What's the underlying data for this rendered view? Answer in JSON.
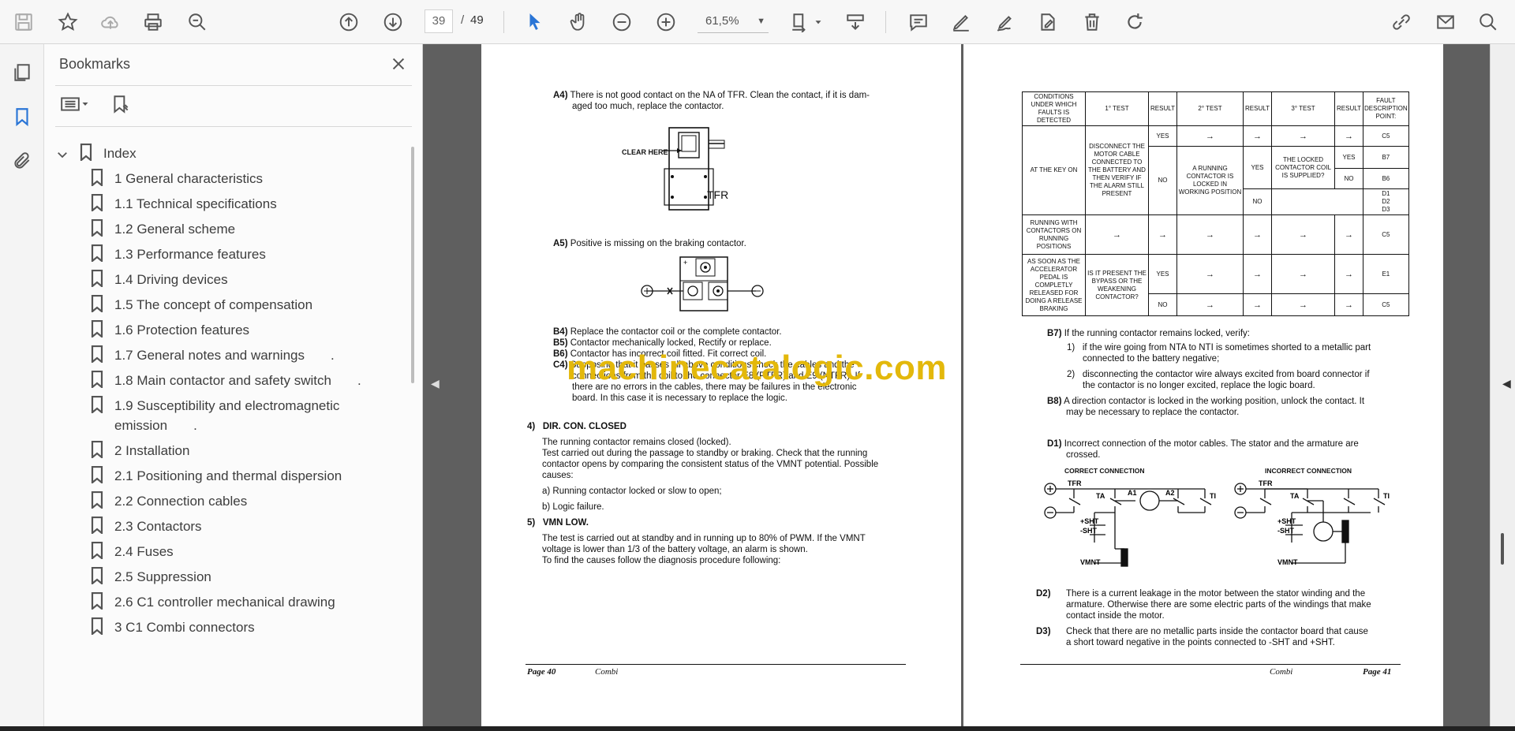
{
  "toolbar": {
    "page_current": "39",
    "page_sep": "/",
    "page_total": "49",
    "zoom": "61,5%"
  },
  "panel": {
    "title": "Bookmarks",
    "bookmarks": [
      {
        "label": "Index"
      },
      {
        "label": "1 General characteristics"
      },
      {
        "label": "1.1 Technical specifications"
      },
      {
        "label": "1.2 General scheme"
      },
      {
        "label": "1.3 Performance features"
      },
      {
        "label": "1.4 Driving devices"
      },
      {
        "label": "1.5 The concept of compensation"
      },
      {
        "label": "1.6 Protection features"
      },
      {
        "label": "1.7 General notes and warnings       ."
      },
      {
        "label": "1.8 Main contactor and safety switch       ."
      },
      {
        "label": "1.9 Susceptibility and electromagnetic emission       ."
      },
      {
        "label": "2 Installation"
      },
      {
        "label": "2.1 Positioning and thermal dispersion"
      },
      {
        "label": "2.2 Connection cables"
      },
      {
        "label": "2.3 Contactors"
      },
      {
        "label": "2.4 Fuses"
      },
      {
        "label": "2.5 Suppression"
      },
      {
        "label": "2.6 C1 controller mechanical drawing"
      },
      {
        "label": "3 C1 Combi connectors"
      }
    ]
  },
  "page40": {
    "a4_tag": "A4)",
    "a4_text1": "There is not good contact on the NA of TFR. Clean the contact, if it is dam-",
    "a4_text2": "aged too much, replace the contactor.",
    "clear_here": "CLEAR HERE",
    "tfr": "TFR",
    "a5_tag": "A5)",
    "a5_text": "Positive is missing on the braking contactor.",
    "b4_tag": "B4)",
    "b4_text": "Replace the contactor coil or the complete contactor.",
    "b5_tag": "B5)",
    "b5_text": "Contactor mechanically locked, Rectify or replace.",
    "b6_tag": "B6)",
    "b6_text": "Contactor has incorrect coil fitted. Fit correct coil.",
    "c4_tag": "C4)",
    "c4_text1": "Supposing that it passes all above conditions check the cables and the",
    "c4_text2": "connections from the coil to the connector E8 (PTFR) and E9 (NTFR). If",
    "c4_text3": "there are no errors in the cables, there may be failures in the electronic",
    "c4_text4": "board. In this case it is necessary to replace the logic.",
    "s4_num": "4)",
    "s4_title": "DIR. CON. CLOSED",
    "s4_p1": "The running contactor remains closed (locked).",
    "s4_p2": "Test carried out during the passage to standby or braking. Check that the running",
    "s4_p3": "contactor opens by comparing the consistent status of the VMNT potential. Possible",
    "s4_p4": "causes:",
    "s4_a": "a) Running contactor locked or slow to open;",
    "s4_b": "b) Logic failure.",
    "s5_num": "5)",
    "s5_title": "VMN LOW.",
    "s5_p1": "The test is carried out at standby and in running up to 80% of PWM. If the VMNT",
    "s5_p2": "voltage is lower than 1/3 of the battery voltage, an alarm is shown.",
    "s5_p3": "To find the causes follow the diagnosis procedure following:",
    "foot_page": "Page 40",
    "foot_name": "Combi"
  },
  "page41": {
    "table": {
      "h_cond": "CONDITIONS UNDER WHICH FAULTS IS DETECTED",
      "h_t1": "1° TEST",
      "h_res": "RESULT",
      "h_t2": "2° TEST",
      "h_t3": "3° TEST",
      "h_fault": "FAULT DESCRIPTION POINT:",
      "at_key_on": "AT THE KEY ON",
      "disconnect": "DISCONNECT THE MOTOR CABLE CONNECTED TO THE BATTERY AND THEN VERIFY IF THE ALARM STILL PRESENT",
      "yes": "YES",
      "no": "NO",
      "arrow": "→",
      "c5": "C5",
      "running_locked": "A RUNNING CONTACTOR IS LOCKED IN WORKING POSITION",
      "coil_supplied": "THE LOCKED CONTACTOR COIL IS SUPPLIED?",
      "b7": "B7",
      "b6": "B6",
      "d1": "D1",
      "d2": "D2",
      "d3": "D3",
      "running_with": "RUNNING WITH CONTACTORS ON RUNNING POSITIONS",
      "as_soon": "AS SOON AS THE ACCELERATOR PEDAL IS COMPLETLY RELEASED FOR DOING A RELEASE BRAKING",
      "bypass": "IS IT PRESENT THE BYPASS OR THE WEAKENING CONTACTOR?",
      "e1": "E1"
    },
    "b7_tag": "B7)",
    "b7_text": "If the running contactor remains locked, verify:",
    "b7_1n": "1)",
    "b7_1a": "if the wire going from NTA to NTI is sometimes shorted to a metallic part",
    "b7_1b": "connected to the battery negative;",
    "b7_2n": "2)",
    "b7_2a": "disconnecting the contactor wire always excited from board connector if",
    "b7_2b": "the contactor is no longer excited, replace the logic board.",
    "b8_tag": "B8)",
    "b8_a": "A direction contactor is locked in the working position, unlock the contact. It",
    "b8_b": "may be necessary to replace the contactor.",
    "d1_tag": "D1)",
    "d1_a": "Incorrect connection of the motor cables. The stator and the armature are",
    "d1_b": "crossed.",
    "correct": "CORRECT CONNECTION",
    "incorrect": "INCORRECT CONNECTION",
    "tfr": "TFR",
    "ta": "TA",
    "a1": "A1",
    "a2": "A2",
    "ti": "TI",
    "psht": "+SHT",
    "msht": "-SHT",
    "vmnt": "VMNT",
    "d2_tag": "D2)",
    "d2_a": "There is a current leakage in the motor between the stator winding and the",
    "d2_b": "armature. Otherwise there are some electric parts of the windings that make",
    "d2_c": "contact inside the motor.",
    "d3_tag": "D3)",
    "d3_a": "Check that there are no metallic parts inside the contactor board that cause",
    "d3_b": "a short toward negative in the points connected to -SHT and +SHT.",
    "foot_name": "Combi",
    "foot_page": "Page 41"
  },
  "watermark": "machinecatalogic.com"
}
